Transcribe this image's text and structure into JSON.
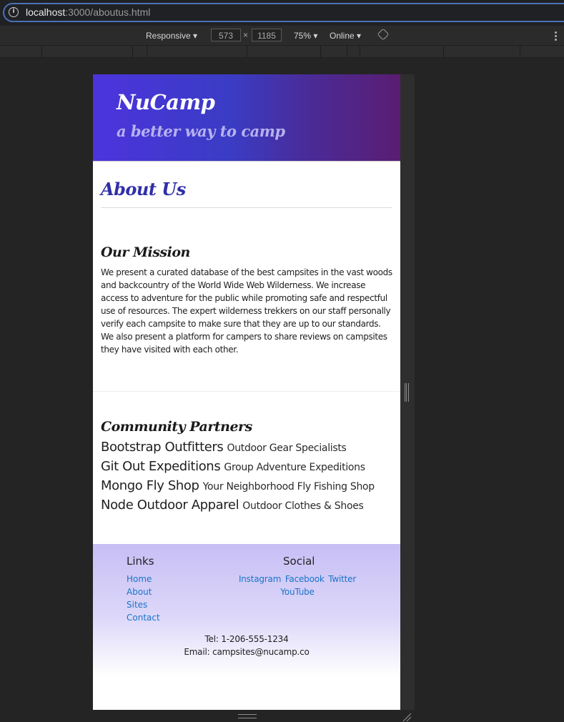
{
  "browser": {
    "url_host": "localhost",
    "url_path": ":3000/aboutus.html"
  },
  "devtools": {
    "device": "Responsive ▾",
    "width": "573",
    "times": "×",
    "height": "1185",
    "zoom": "75% ▾",
    "network": "Online ▾",
    "icons": [
      "info-icon",
      "rotate-icon",
      "kebab-icon"
    ]
  },
  "header": {
    "brand": "NuCamp",
    "tagline": "a better way to camp"
  },
  "about": {
    "title": "About Us"
  },
  "mission": {
    "title": "Our Mission",
    "text": "We present a curated database of the best campsites in the vast woods and backcountry of the World Wide Web Wilderness. We increase access to adventure for the public while promoting safe and respectful use of resources. The expert wilderness trekkers on our staff personally verify each campsite to make sure that they are up to our standards. We also present a platform for campers to share reviews on campsites they have visited with each other."
  },
  "partners": {
    "title": "Community Partners",
    "items": [
      {
        "name": "Bootstrap Outfitters",
        "desc": "Outdoor Gear Specialists"
      },
      {
        "name": "Git Out Expeditions",
        "desc": "Group Adventure Expeditions"
      },
      {
        "name": "Mongo Fly Shop",
        "desc": "Your Neighborhood Fly Fishing Shop"
      },
      {
        "name": "Node Outdoor Apparel",
        "desc": "Outdoor Clothes & Shoes"
      }
    ]
  },
  "footer": {
    "links_heading": "Links",
    "links": [
      "Home",
      "About",
      "Sites",
      "Contact"
    ],
    "social_heading": "Social",
    "social": [
      "Instagram",
      "Facebook",
      "Twitter",
      "YouTube"
    ],
    "phone": "Tel: 1-206-555-1234",
    "email": "Email: campsites@nucamp.co"
  },
  "colors": {
    "gradient_start": "#4c34dd",
    "gradient_end": "#5a1d72",
    "heading_blue": "#2f2fa8",
    "link_blue": "#1a73c9"
  }
}
